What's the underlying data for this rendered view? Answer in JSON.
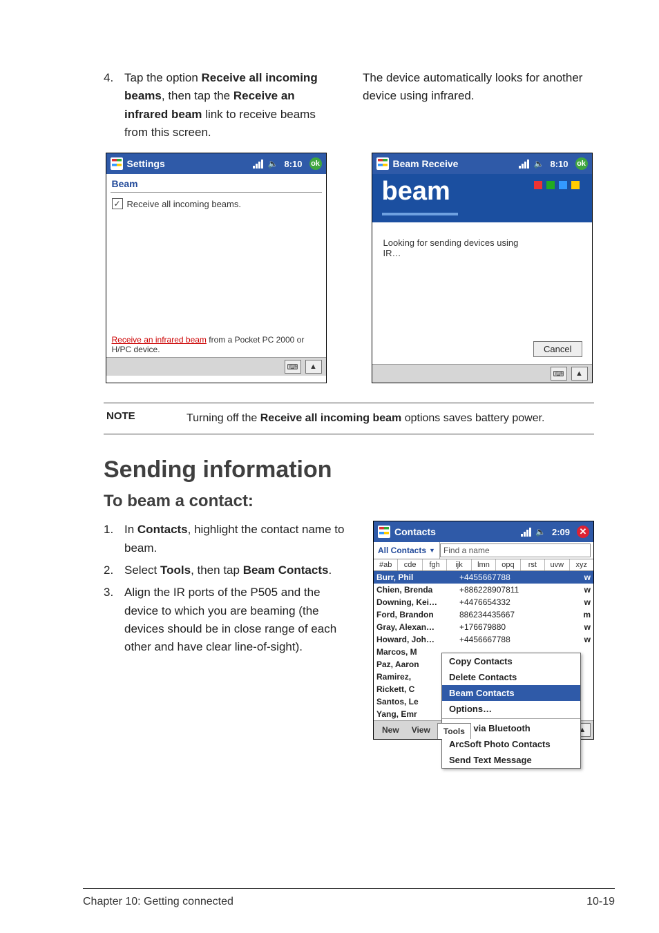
{
  "intro": {
    "step4_num": "4.",
    "step4_a": "Tap the option ",
    "step4_b": "Receive all incoming beams",
    "step4_c": ", then tap the ",
    "step4_d": "Receive an infrared beam",
    "step4_e": " link to receive beams from this screen.",
    "right_para": "The device automatically looks for another device using infrared."
  },
  "shot_settings": {
    "title": "Settings",
    "time": "8:10",
    "ok": "ok",
    "heading": "Beam",
    "checkbox_label": "Receive all incoming beams.",
    "link_text": "Receive an infrared beam",
    "link_tail": " from a Pocket PC 2000 or H/PC device."
  },
  "shot_receive": {
    "title": "Beam Receive",
    "time": "8:10",
    "ok": "ok",
    "banner": "beam",
    "body_line1": "Looking for sending devices using",
    "body_line2": "IR…",
    "cancel": "Cancel"
  },
  "note": {
    "label": "NOTE",
    "text_a": "Turning off the ",
    "text_b": "Receive all incoming beam",
    "text_c": " options saves battery power."
  },
  "section_title": "Sending information",
  "sub_title": "To beam a contact:",
  "steps2": {
    "s1_num": "1.",
    "s1_a": " In ",
    "s1_b": "Contacts",
    "s1_c": ", highlight the contact name to beam.",
    "s2_num": "2.",
    "s2_a": " Select ",
    "s2_b": "Tools",
    "s2_c": ", then tap ",
    "s2_d": "Beam Contacts",
    "s2_e": ".",
    "s3_num": "3.",
    "s3_text": " Align the IR ports of the P505 and the device to which you are beaming (the devices should be in close range of each other and have clear line-of-sight)."
  },
  "shot_contacts": {
    "title": "Contacts",
    "time": "2:09",
    "all_contacts": "All Contacts",
    "find": "Find a name",
    "alpha": [
      "#ab",
      "cde",
      "fgh",
      "ijk",
      "lmn",
      "opq",
      "rst",
      "uvw",
      "xyz"
    ],
    "rows": [
      {
        "name": "Burr, Phil",
        "num": "+4455667788",
        "tag": "w",
        "sel": true
      },
      {
        "name": "Chien, Brenda",
        "num": "+886228907811",
        "tag": "w"
      },
      {
        "name": "Downing, Kei…",
        "num": "+4476654332",
        "tag": "w"
      },
      {
        "name": "Ford, Brandon",
        "num": "886234435667",
        "tag": "m"
      },
      {
        "name": "Gray, Alexan…",
        "num": "+176679880",
        "tag": "w"
      },
      {
        "name": "Howard, Joh…",
        "num": "+4456667788",
        "tag": "w"
      },
      {
        "name": "Marcos, M",
        "num": "",
        "tag": ""
      },
      {
        "name": "Paz, Aaron",
        "num": "",
        "tag": ""
      },
      {
        "name": "Ramirez, ",
        "num": "",
        "tag": ""
      },
      {
        "name": "Rickett, C",
        "num": "",
        "tag": ""
      },
      {
        "name": "Santos, Le",
        "num": "",
        "tag": ""
      },
      {
        "name": "Yang, Emr",
        "num": "",
        "tag": ""
      }
    ],
    "menu": {
      "items": [
        "Copy Contacts",
        "Delete Contacts",
        "Beam Contacts",
        "Options…",
        "Send via Bluetooth",
        "ArcSoft Photo Contacts",
        "Send Text Message"
      ],
      "sel_index": 2
    },
    "menubar": [
      "New",
      "View",
      "Tools"
    ]
  },
  "footer": {
    "left": "Chapter 10: Getting connected",
    "right": "10-19"
  }
}
